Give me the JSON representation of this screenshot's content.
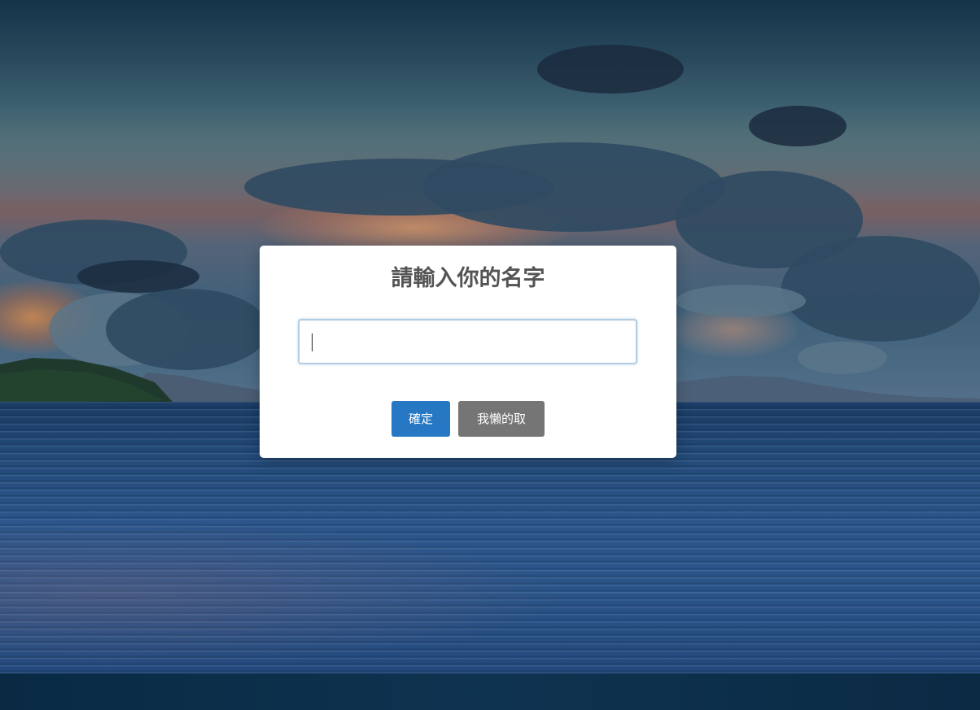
{
  "dialog": {
    "title": "請輸入你的名字",
    "input_value": "",
    "confirm_label": "確定",
    "cancel_label": "我懶的取"
  },
  "colors": {
    "confirm_button": "#2778c4",
    "cancel_button": "#757575",
    "title_text": "#545454",
    "input_border_focus": "#b2cde2"
  }
}
